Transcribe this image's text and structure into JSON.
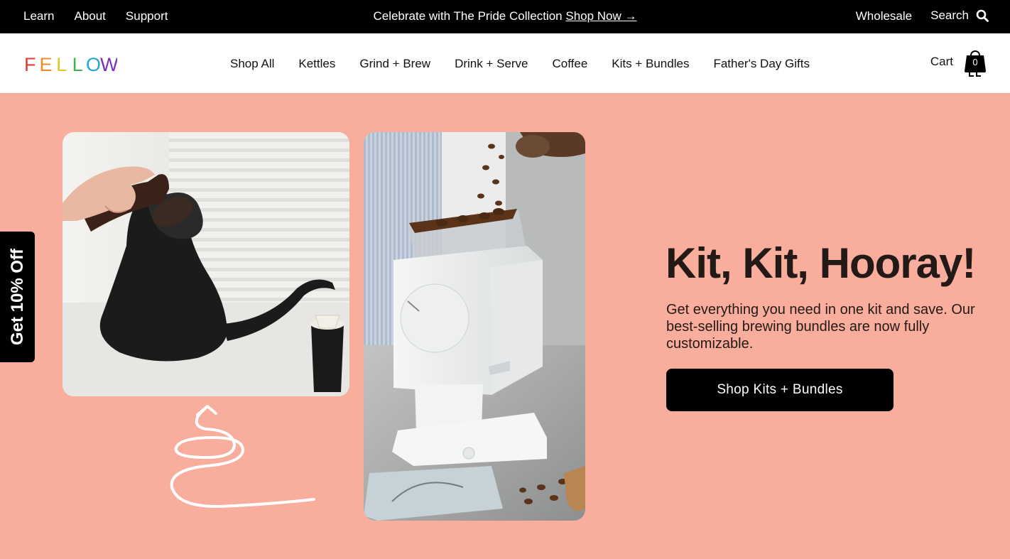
{
  "announcement": {
    "links_left": [
      "Learn",
      "About",
      "Support"
    ],
    "promo_text": "Celebrate with The Pride Collection ",
    "promo_link": "Shop Now →",
    "wholesale": "Wholesale",
    "search_label": "Search"
  },
  "header": {
    "logo_letters": [
      "F",
      "E",
      "L",
      "L",
      "O",
      "W"
    ],
    "logo_colors": [
      "#e23a3a",
      "#f08a24",
      "#e8c21e",
      "#3cb44b",
      "#1fa9d6",
      "#7a2fc0"
    ],
    "nav": [
      "Shop All",
      "Kettles",
      "Grind + Brew",
      "Drink + Serve",
      "Coffee",
      "Kits + Bundles",
      "Father's Day Gifts"
    ],
    "cart_label": "Cart",
    "cart_count": "0"
  },
  "hero": {
    "headline": "Kit, Kit, Hooray!",
    "subcopy": "Get everything you need in one kit and save. Our best-selling brewing bundles are now fully customizable.",
    "cta": "Shop Kits + Bundles",
    "background": "#f8ad9d"
  },
  "discount_tab": "Get 10% Off"
}
